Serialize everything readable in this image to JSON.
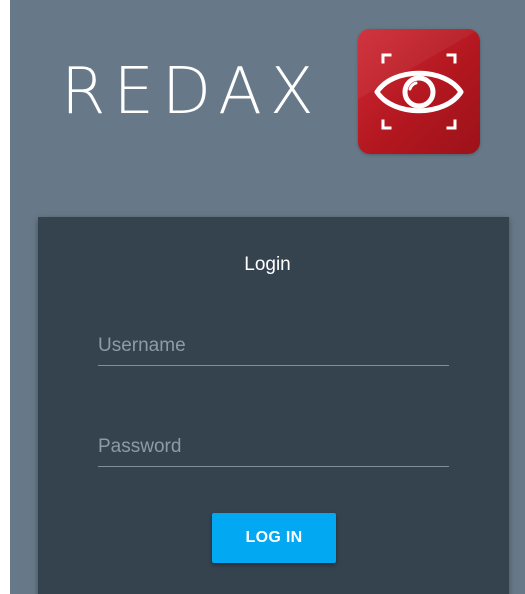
{
  "brand": {
    "name": "REDAX",
    "logo_icon": "eye-scan-icon",
    "logo_color": "#c0202a"
  },
  "login": {
    "title": "Login",
    "username": {
      "value": "",
      "placeholder": "Username"
    },
    "password": {
      "value": "",
      "placeholder": "Password"
    },
    "submit_label": "LOG IN"
  },
  "colors": {
    "background": "#677988",
    "card": "#35434f",
    "accent": "#02a8f2"
  }
}
